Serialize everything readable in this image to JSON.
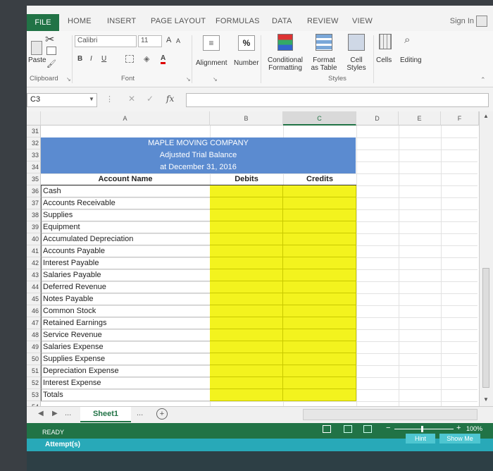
{
  "tabs": {
    "file": "FILE",
    "home": "HOME",
    "insert": "INSERT",
    "page_layout": "PAGE LAYOUT",
    "formulas": "FORMULAS",
    "data": "DATA",
    "review": "REVIEW",
    "view": "VIEW",
    "sign_in": "Sign In"
  },
  "ribbon": {
    "paste": "Paste",
    "font_name": "Calibri",
    "font_size": "11",
    "grow_font": "A",
    "shrink_font": "A",
    "bold": "B",
    "italic": "I",
    "underline": "U",
    "font_color": "A",
    "alignment": "Alignment",
    "number": "Number",
    "percent": "%",
    "conditional_formatting": "Conditional Formatting",
    "format_as_table": "Format as Table",
    "cell_styles": "Cell Styles",
    "cells": "Cells",
    "editing": "Editing",
    "grp_clipboard": "Clipboard",
    "grp_font": "Font",
    "grp_styles": "Styles"
  },
  "formula_bar": {
    "name_box": "C3",
    "fx": "fx",
    "cancel": "✕",
    "enter": "✓"
  },
  "columns": [
    "A",
    "B",
    "C",
    "D",
    "E",
    "F"
  ],
  "rows": [
    "31",
    "32",
    "33",
    "34",
    "35",
    "36",
    "37",
    "38",
    "39",
    "40",
    "41",
    "42",
    "43",
    "44",
    "45",
    "46",
    "47",
    "48",
    "49",
    "50",
    "51",
    "52",
    "53",
    "54"
  ],
  "report": {
    "company": "MAPLE MOVING COMPANY",
    "title": "Adjusted Trial Balance",
    "date": "at December 31, 2016",
    "col_account": "Account Name",
    "col_debits": "Debits",
    "col_credits": "Credits",
    "accounts": [
      "Cash",
      "Accounts Receivable",
      "Supplies",
      "Equipment",
      "Accumulated Depreciation",
      "Accounts Payable",
      "Interest Payable",
      "Salaries Payable",
      "Deferred Revenue",
      "Notes Payable",
      "Common Stock",
      "Retained Earnings",
      "Service Revenue",
      "Salaries Expense",
      "Supplies Expense",
      "Depreciation Expense",
      "Interest Expense",
      "Totals"
    ]
  },
  "sheets": {
    "active": "Sheet1",
    "more": "...",
    "add": "+"
  },
  "status": {
    "ready": "READY",
    "zoom": "100%",
    "attempts": "Attempt(s)",
    "hint": "Hint",
    "show_me": "Show Me"
  },
  "colors": {
    "excel_green": "#217346",
    "title_band": "#5b8bd0",
    "input_yellow": "#f3f31e",
    "attempts_bar": "#28a9b8"
  }
}
